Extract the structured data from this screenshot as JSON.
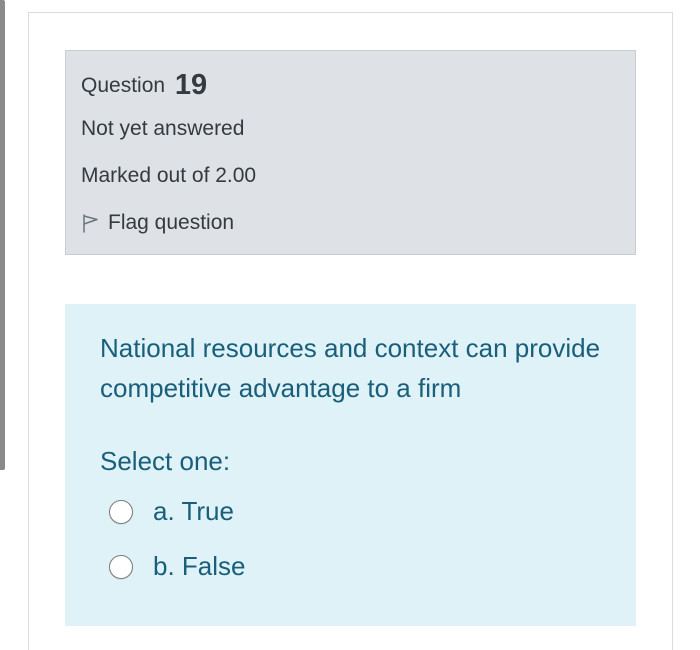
{
  "question": {
    "label": "Question",
    "number": "19",
    "state": "Not yet answered",
    "grade": "Marked out of 2.00",
    "flag_label": "Flag question",
    "text": "National resources and context can provide competitive advantage to a firm",
    "prompt": "Select one:",
    "options": [
      {
        "label": "a. True",
        "selected": false
      },
      {
        "label": "b. False",
        "selected": false
      }
    ]
  },
  "icons": {
    "flag": "flag-outline-icon"
  },
  "colors": {
    "info_background": "#dee2e6",
    "content_background": "#def2f8",
    "content_text": "#1a5f7a",
    "info_text": "#343a40"
  }
}
